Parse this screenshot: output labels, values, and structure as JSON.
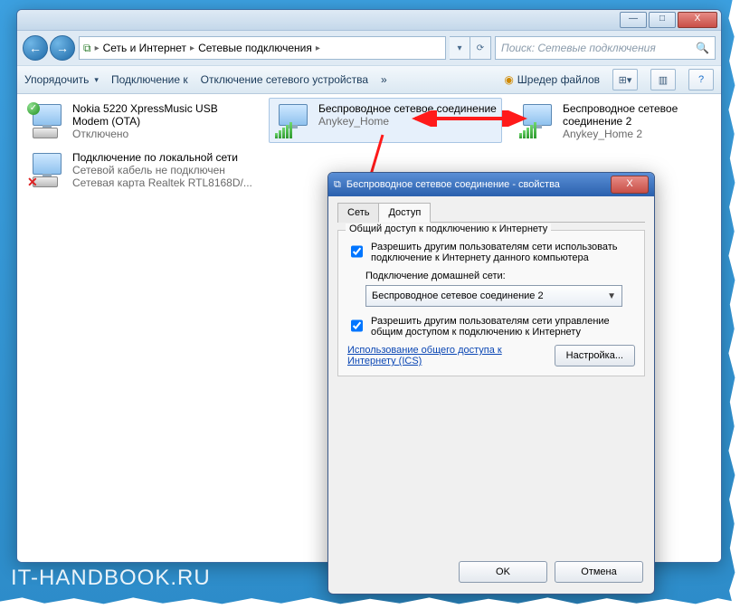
{
  "window": {
    "minimize": "—",
    "maximize": "□",
    "close": "X"
  },
  "nav": {
    "back": "←",
    "forward": "→"
  },
  "breadcrumb": {
    "seg1": "Сеть и Интернет",
    "seg2": "Сетевые подключения",
    "sep": "▸"
  },
  "addrbuttons": {
    "dd": "▾",
    "refresh": "⟳"
  },
  "search": {
    "placeholder": "Поиск: Сетевые подключения",
    "icon": "🔍"
  },
  "toolbar": {
    "organize": "Упорядочить",
    "connect": "Подключение к",
    "disable": "Отключение сетевого устройства",
    "chevrons": "»",
    "shredder": "Шредер файлов",
    "view": "⊞▾",
    "preview": "▥",
    "help": "?"
  },
  "connections": [
    {
      "title": "Nokia 5220 XpressMusic USB Modem (OTA)",
      "sub1": "Отключено",
      "sub2": ""
    },
    {
      "title": "Беспроводное сетевое соединение",
      "sub1": "Anykey_Home",
      "sub2": ""
    },
    {
      "title": "Беспроводное сетевое соединение 2",
      "sub1": "Anykey_Home 2",
      "sub2": ""
    },
    {
      "title": "Подключение по локальной сети",
      "sub1": "Сетевой кабель не подключен",
      "sub2": "Сетевая карта Realtek RTL8168D/..."
    }
  ],
  "dialog": {
    "title": "Беспроводное сетевое соединение - свойства",
    "close": "X",
    "tabs": {
      "net": "Сеть",
      "share": "Доступ"
    },
    "group_title": "Общий доступ к подключению к Интернету",
    "chk1": "Разрешить другим пользователям сети использовать подключение к Интернету данного компьютера",
    "home_label": "Подключение домашней сети:",
    "combo_value": "Беспроводное сетевое соединение 2",
    "chk2": "Разрешить другим пользователям сети управление общим доступом к подключению к Интернету",
    "ics_link": "Использование общего доступа к Интернету (ICS)",
    "settings_btn": "Настройка...",
    "ok": "OK",
    "cancel": "Отмена"
  },
  "watermark": "IT-HANDBOOK.RU"
}
